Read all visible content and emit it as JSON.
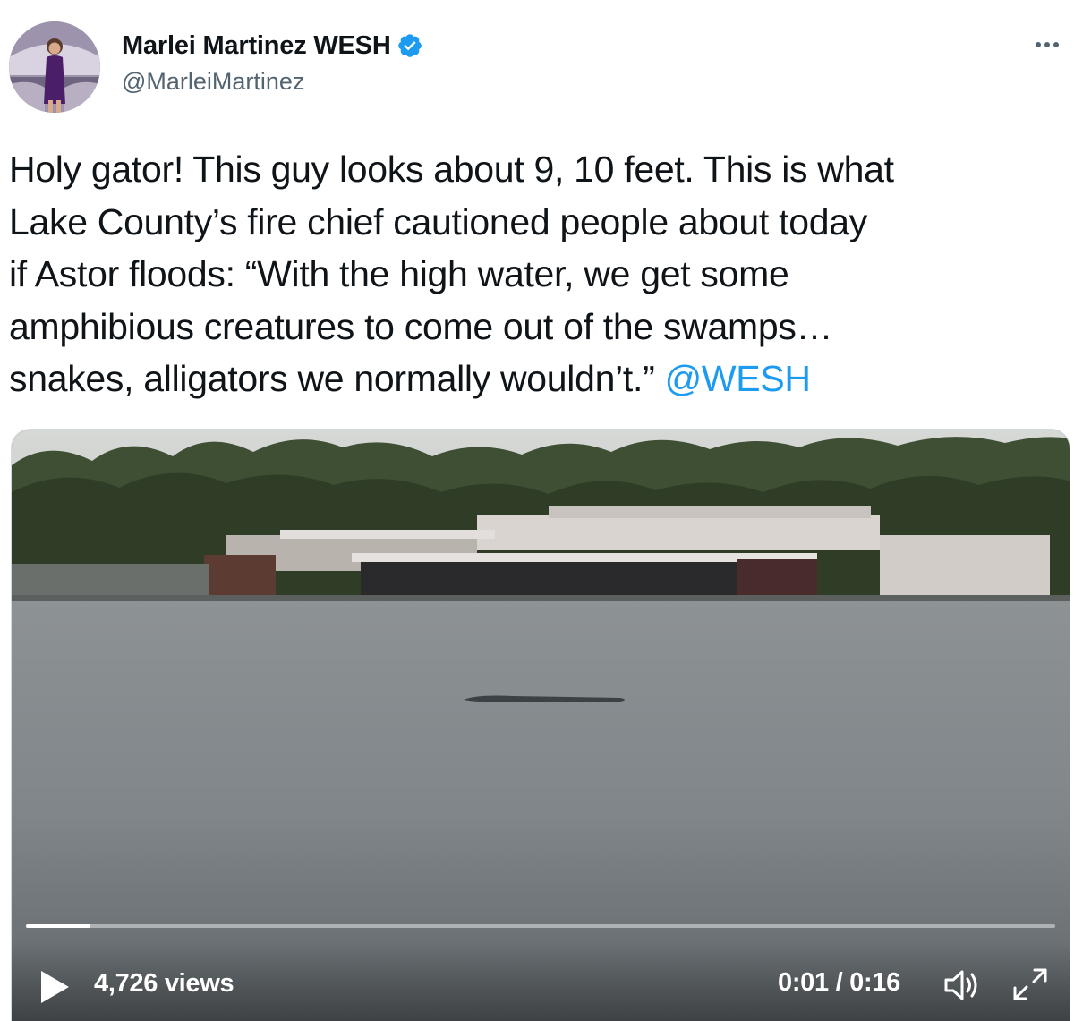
{
  "author": {
    "display_name": "Marlei Martinez WESH",
    "handle": "@MarleiMartinez",
    "avatar_icon": "profile-photo",
    "verified_icon": "verified-badge-icon",
    "verified_color": "#1d9bf0"
  },
  "more_icon": "more-options-icon",
  "tweet": {
    "lines": [
      "Holy gator! This guy looks about 9, 10 feet. This is what",
      "Lake County’s fire chief cautioned people about today",
      "if Astor floods: “With the high water, we get some",
      "amphibious creatures to come out of the swamps…",
      "snakes, alligators we normally wouldn’t.” "
    ],
    "mention": "@WESH",
    "mention_color": "#1d9bf0"
  },
  "video": {
    "views": "4,726 views",
    "time": "0:01 / 0:16",
    "progress_fraction": 0.0625,
    "play_icon": "play-icon",
    "volume_icon": "volume-icon",
    "fullscreen_icon": "fullscreen-icon"
  }
}
